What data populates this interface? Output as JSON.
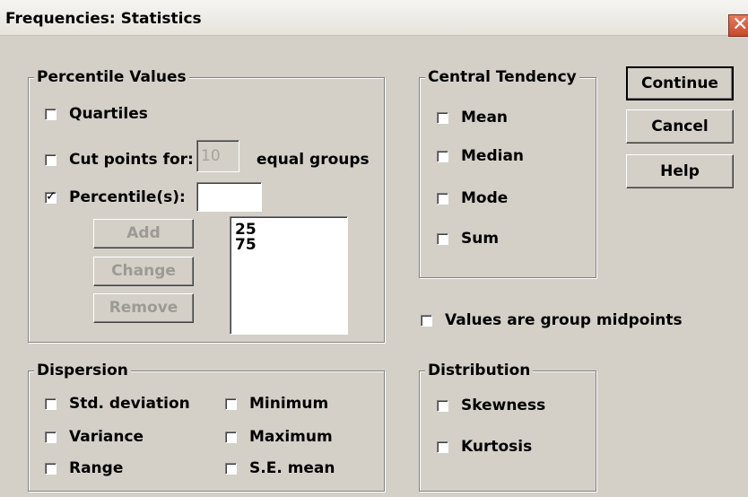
{
  "window": {
    "title": "Frequencies: Statistics"
  },
  "percentile_values": {
    "legend": "Percentile Values",
    "quartiles": {
      "label": "Quartiles",
      "checked": false
    },
    "cut_points": {
      "label": "Cut points for:",
      "value": "10",
      "suffix": "equal groups",
      "checked": false
    },
    "percentiles": {
      "label": "Percentile(s):",
      "value": "",
      "checked": true,
      "check_glyph": "✓"
    },
    "buttons": {
      "add": "Add",
      "change": "Change",
      "remove": "Remove"
    },
    "list": [
      "25",
      "75"
    ]
  },
  "central_tendency": {
    "legend": "Central Tendency",
    "items": [
      "Mean",
      "Median",
      "Mode",
      "Sum"
    ]
  },
  "actions": {
    "continue": "Continue",
    "cancel": "Cancel",
    "help": "Help"
  },
  "group_midpoints": {
    "label": "Values are group midpoints",
    "checked": false
  },
  "dispersion": {
    "legend": "Dispersion",
    "items": [
      "Std. deviation",
      "Minimum",
      "Variance",
      "Maximum",
      "Range",
      "S.E. mean"
    ]
  },
  "distribution": {
    "legend": "Distribution",
    "items": [
      "Skewness",
      "Kurtosis"
    ]
  }
}
